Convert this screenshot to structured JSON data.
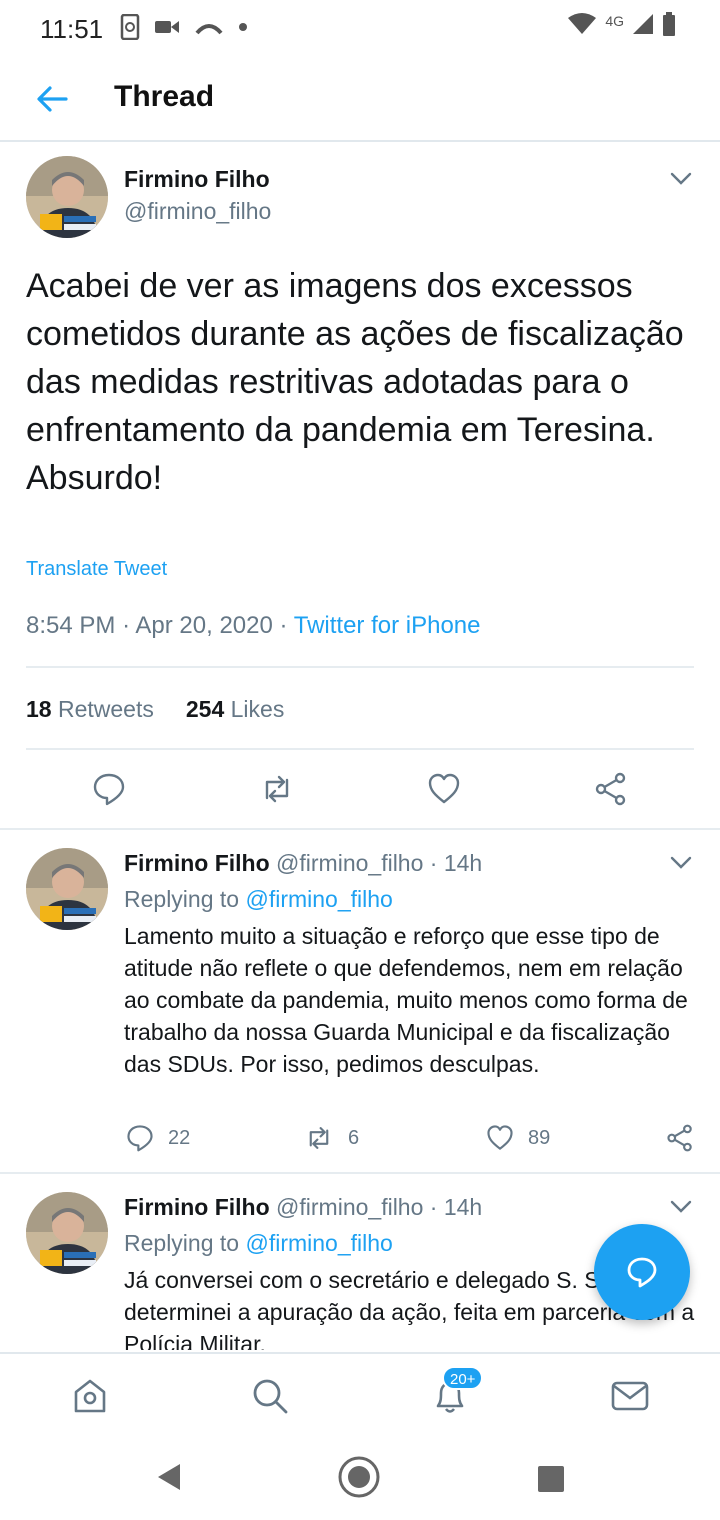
{
  "status_bar": {
    "time": "11:51",
    "network": "4G"
  },
  "header": {
    "title": "Thread"
  },
  "main_tweet": {
    "name": "Firmino Filho",
    "handle": "@firmino_filho",
    "text": "Acabei de ver as imagens dos excessos cometidos durante as ações de fiscalização das medidas restritivas adotadas para o enfrentamento da pandemia em Teresina.\nAbsurdo!",
    "translate": "Translate Tweet",
    "time": "8:54 PM",
    "date": "Apr 20, 2020",
    "dot": "·",
    "source": "Twitter for iPhone",
    "retweets_count": "18",
    "retweets_label": "Retweets",
    "likes_count": "254",
    "likes_label": "Likes"
  },
  "replies": [
    {
      "name": "Firmino Filho",
      "handle": "@firmino_filho",
      "age": "14h",
      "replying_label": "Replying to",
      "replying_to": "@firmino_filho",
      "text": "Lamento muito a situação e reforço que esse tipo de atitude não reflete o que defendemos, nem em relação ao combate da pandemia, muito menos como forma de trabalho da nossa Guarda Municipal e da fiscalização das SDUs. Por isso, pedimos desculpas.",
      "reply_count": "22",
      "retweet_count": "6",
      "like_count": "89"
    },
    {
      "name": "Firmino Filho",
      "handle": "@firmino_filho",
      "age": "14h",
      "replying_label": "Replying to",
      "replying_to": "@firmino_filho",
      "text": "Já conversei com o secretário e delegado S. Silveira e determinei a apuração da ação, feita em parceria com a Polícia Militar."
    }
  ],
  "tabbar": {
    "notifications_badge": "20+"
  },
  "colors": {
    "accent": "#1da1f2",
    "secondary_text": "#657786",
    "divider": "#e6ecf0"
  }
}
